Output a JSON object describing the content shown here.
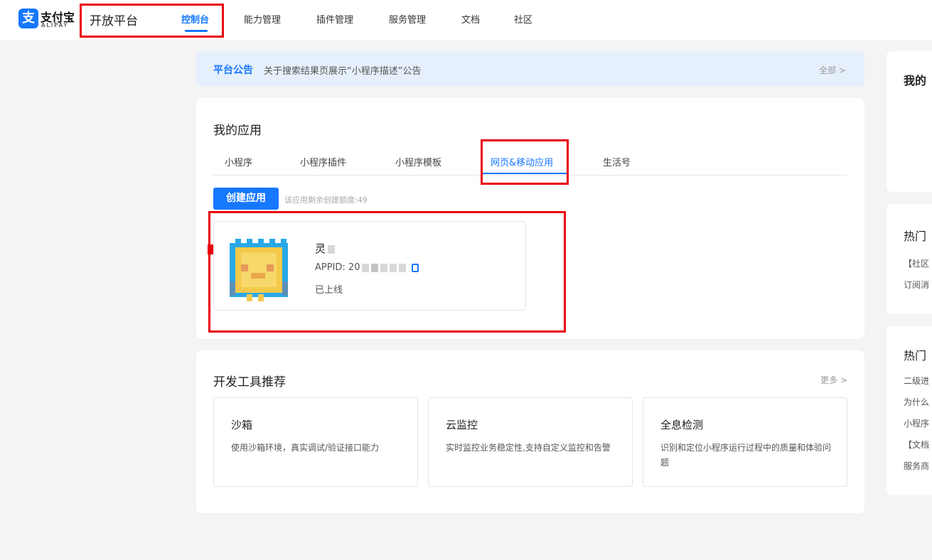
{
  "header": {
    "logo": {
      "mark": "支",
      "cn": "支付宝",
      "en": "ALIPAY"
    },
    "platform": "开放平台",
    "nav": [
      "控制台",
      "能力管理",
      "插件管理",
      "服务管理",
      "文档",
      "社区"
    ]
  },
  "notice": {
    "title": "平台公告",
    "text": "关于搜索结果页展示“小程序描述”公告",
    "more": "全部 >"
  },
  "apps": {
    "title": "我的应用",
    "tabs": [
      "小程序",
      "小程序插件",
      "小程序模板",
      "网页&移动应用",
      "生活号"
    ],
    "active_tab": 3,
    "create_button": "创建应用",
    "quota": "该应用剩余创建额度:49",
    "card": {
      "name": "灵",
      "appid": "APPID: 20",
      "status": "已上线"
    }
  },
  "tools": {
    "title": "开发工具推荐",
    "more": "更多 >",
    "items": [
      {
        "title": "沙箱",
        "desc": "使用沙箱环境，真实调试/验证接口能力"
      },
      {
        "title": "云监控",
        "desc": "实时监控业务稳定性,支持自定义监控和告警"
      },
      {
        "title": "全息检测",
        "desc": "识别和定位小程序运行过程中的质量和体验问题"
      }
    ]
  },
  "sidebar": {
    "card1_title": "我的",
    "card2_title": "热门",
    "card2_lines": [
      "【社区",
      "订阅消"
    ],
    "card3_title": "热门",
    "card3_lines": [
      "二级进",
      "为什么",
      "小程序",
      "【文档",
      "服务商"
    ]
  },
  "colors": {
    "accent": "#1677ff",
    "highlight": "#e8000b",
    "notice_bg": "#e6f0fc"
  }
}
